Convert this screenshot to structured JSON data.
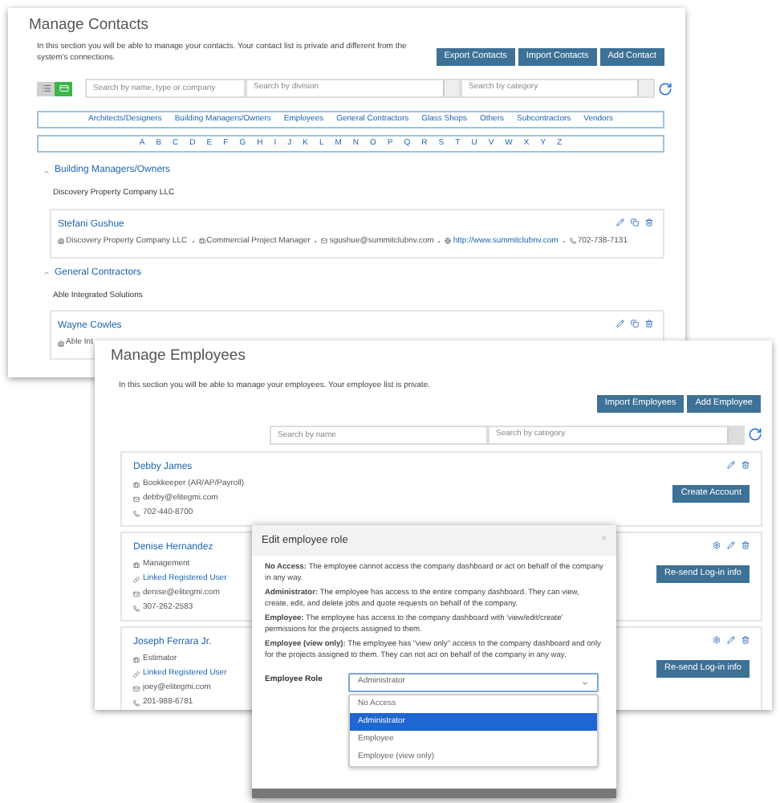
{
  "contacts_window": {
    "title": "Manage Contacts",
    "intro": "In this section you will be able to manage your contacts. Your contact list is private and different from the system's connections.",
    "buttons": [
      "Export Contacts",
      "Import Contacts",
      "Add Contact"
    ],
    "view_toggle": [
      {
        "kind": "list",
        "selected": false
      },
      {
        "kind": "card",
        "selected": true
      }
    ],
    "search": {
      "placeholder": "Search by name, type or company"
    },
    "division": {
      "placeholder": "Search by division"
    },
    "category": {
      "placeholder": "Search by category"
    },
    "categories": [
      "Architects/Designers",
      "Building Managers/Owners",
      "Employees",
      "General Contractors",
      "Glass Shops",
      "Others",
      "Subcontractors",
      "Vendors"
    ],
    "letters": [
      "A",
      "B",
      "C",
      "D",
      "E",
      "F",
      "G",
      "H",
      "I",
      "J",
      "K",
      "L",
      "M",
      "N",
      "O",
      "P",
      "Q",
      "R",
      "S",
      "T",
      "U",
      "V",
      "W",
      "X",
      "Y",
      "Z"
    ],
    "groups": [
      {
        "title": "Building Managers/Owners",
        "companies": [
          {
            "name": "Discovery Property Company LLC",
            "contacts": [
              {
                "name": "Stefani Gushue",
                "details": [
                  {
                    "kind": "company",
                    "text": "Discovery Property Company LLC"
                  },
                  {
                    "kind": "title",
                    "text": "Commercial Project Manager"
                  },
                  {
                    "kind": "email",
                    "text": "sgushue@summitclubnv.com"
                  },
                  {
                    "kind": "website",
                    "text": "http://www.summitclubnv.com"
                  },
                  {
                    "kind": "phone",
                    "text": "702-738-7131"
                  }
                ]
              }
            ]
          }
        ]
      },
      {
        "title": "General Contractors",
        "companies": [
          {
            "name": "Able Integrated Solutions",
            "contacts": [
              {
                "name": "Wayne Cowles",
                "details": [
                  {
                    "kind": "company",
                    "text": "Able Int"
                  }
                ]
              }
            ]
          }
        ]
      }
    ]
  },
  "employees_window": {
    "title": "Manage Employees",
    "intro": "In this section you will be able to manage your employees. Your employee list is private.",
    "buttons": [
      "Import Employees",
      "Add Employee"
    ],
    "search": {
      "placeholder": "Search by name"
    },
    "category": {
      "placeholder": "Search by category"
    },
    "employees": [
      {
        "name": "Debby James",
        "has_settings": false,
        "details": [
          {
            "kind": "role",
            "text": "Bookkeeper (AR/AP/Payroll)"
          },
          {
            "kind": "email",
            "text": "debby@elitegmi.com"
          },
          {
            "kind": "phone",
            "text": "702-440-8700"
          }
        ],
        "action": "Create Account"
      },
      {
        "name": "Denise Hernandez",
        "has_settings": true,
        "details": [
          {
            "kind": "role",
            "text": "Management"
          },
          {
            "kind": "link",
            "text": "Linked Registered User"
          },
          {
            "kind": "email",
            "text": "denise@elitegmi.com"
          },
          {
            "kind": "phone",
            "text": "307-262-2583"
          }
        ],
        "action": "Re-send Log-in info"
      },
      {
        "name": "Joseph Ferrara Jr.",
        "has_settings": true,
        "details": [
          {
            "kind": "role",
            "text": "Estimator"
          },
          {
            "kind": "link",
            "text": "Linked Registered User"
          },
          {
            "kind": "email",
            "text": "joey@elitegmi.com"
          },
          {
            "kind": "phone",
            "text": "201-988-6781"
          }
        ],
        "action": "Re-send Log-in info"
      }
    ]
  },
  "role_dialog": {
    "title": "Edit employee role",
    "close": "×",
    "definitions": [
      "**No Access:** The employee cannot access the company dashboard or act on behalf of the company in any way.",
      "**Administrator:** The employee has access to the entire company dashboard. They can view, create, edit, and delete jobs and quote requests on behalf of the company.",
      "**Employee:** The employee has access to the company dashboard with 'view/edit/create' permissions for the projects assigned to them.",
      "**Employee (view only):** The employee has \"view only\" access to the company dashboard and only for the projects assigned to them. They can not act on behalf of the company in any way."
    ],
    "role_label": "Employee Role",
    "role_value": "Administrator",
    "options": [
      {
        "label": "No Access",
        "selected": false
      },
      {
        "label": "Administrator",
        "selected": true
      },
      {
        "label": "Employee",
        "selected": false
      },
      {
        "label": "Employee (view only)",
        "selected": false
      }
    ]
  }
}
